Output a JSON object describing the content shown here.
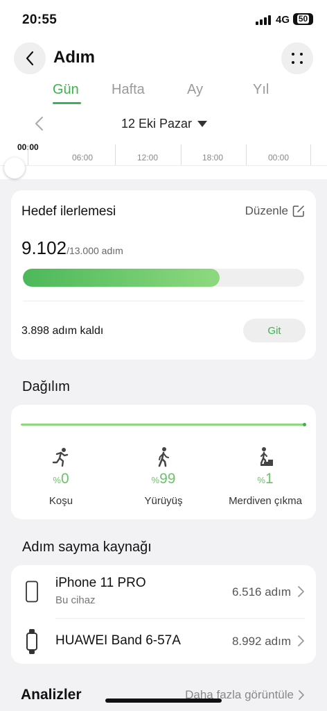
{
  "status_bar": {
    "time": "20:55",
    "network": "4G",
    "battery": "50"
  },
  "header": {
    "title": "Adım"
  },
  "tabs": [
    {
      "label": "Gün",
      "active": true
    },
    {
      "label": "Hafta",
      "active": false
    },
    {
      "label": "Ay",
      "active": false
    },
    {
      "label": "Yıl",
      "active": false
    }
  ],
  "date": {
    "label": "12 Eki Pazar"
  },
  "timeline": {
    "start": "00:00",
    "ticks": [
      "06:00",
      "12:00",
      "18:00",
      "00:00"
    ]
  },
  "goal": {
    "title": "Hedef ilerlemesi",
    "edit_label": "Düzenle",
    "current": "9.102",
    "target": "/13.000 adım",
    "progress": 0.7,
    "remaining": "3.898 adım kaldı",
    "go_label": "Git"
  },
  "distribution": {
    "title": "Dağılım",
    "items": [
      {
        "label": "Koşu",
        "percent_sign": "%",
        "value": "0",
        "icon": "running-icon"
      },
      {
        "label": "Yürüyüş",
        "percent_sign": "%",
        "value": "99",
        "icon": "walking-icon"
      },
      {
        "label": "Merdiven çıkma",
        "percent_sign": "%",
        "value": "1",
        "icon": "stairs-icon"
      }
    ]
  },
  "sources": {
    "title": "Adım sayma kaynağı",
    "items": [
      {
        "name": "iPhone 11 PRO",
        "sub": "Bu cihaz",
        "count": "6.516 adım",
        "icon": "phone-icon"
      },
      {
        "name": "HUAWEI Band 6-57A",
        "count": "8.992 adım",
        "icon": "band-icon"
      }
    ]
  },
  "analysis": {
    "title": "Analizler",
    "more_label": "Daha fazla görüntüle"
  },
  "colors": {
    "accent": "#3eb24f",
    "accent_light": "#8ed97f",
    "background": "#f2f2f4"
  }
}
